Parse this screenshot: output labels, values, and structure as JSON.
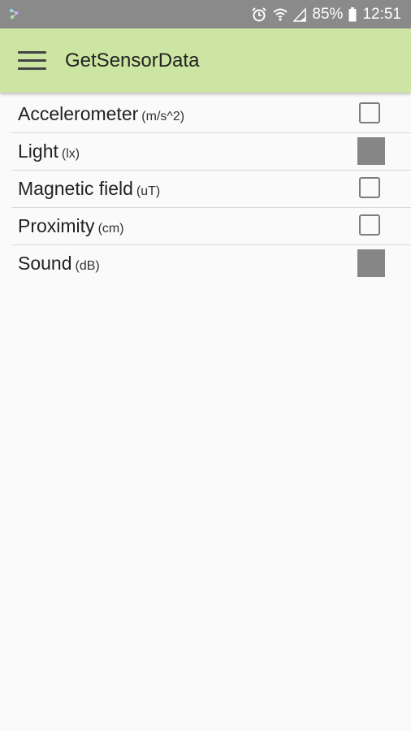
{
  "status_bar": {
    "battery_percent": "85%",
    "time": "12:51",
    "icons": [
      "notification-icon",
      "alarm-icon",
      "wifi-icon",
      "signal-icon",
      "battery-icon"
    ]
  },
  "app_bar": {
    "title": "GetSensorData",
    "background_color": "#cde5a2",
    "menu_icon": "hamburger-menu-icon"
  },
  "sensors": [
    {
      "name": "Accelerometer",
      "unit": "(m/s^2)",
      "checked": false
    },
    {
      "name": "Light",
      "unit": "(lx)",
      "checked": true
    },
    {
      "name": "Magnetic field",
      "unit": "(uT)",
      "checked": false
    },
    {
      "name": "Proximity",
      "unit": "(cm)",
      "checked": false
    },
    {
      "name": "Sound",
      "unit": "(dB)",
      "checked": true
    }
  ]
}
